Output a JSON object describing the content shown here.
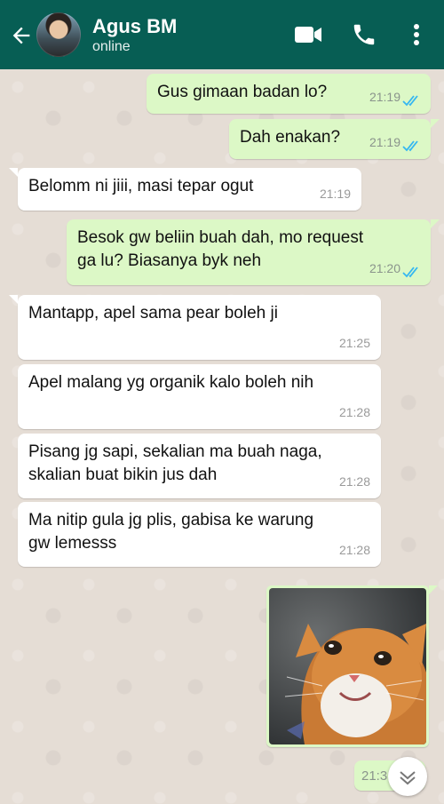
{
  "header": {
    "contact_name": "Agus BM",
    "status": "online",
    "icons": [
      "back-arrow-icon",
      "video-call-icon",
      "phone-icon",
      "more-options-icon"
    ],
    "color": "#075e54"
  },
  "messages": [
    {
      "direction": "out",
      "text": "Gus gimaan badan lo?",
      "time": "21:19",
      "read": true
    },
    {
      "direction": "out",
      "text": "Dah enakan?",
      "time": "21:19",
      "read": true
    },
    {
      "direction": "in",
      "text": "Belomm ni jiii, masi tepar ogut",
      "time": "21:19"
    },
    {
      "direction": "out",
      "text_lines": [
        "Besok gw beliin buah dah, mo request",
        "ga lu? Biasanya byk neh"
      ],
      "time": "21:20",
      "read": true
    },
    {
      "direction": "in",
      "text": "Mantapp, apel sama pear boleh ji",
      "time": "21:25"
    },
    {
      "direction": "in",
      "text": "Apel malang yg organik kalo boleh nih",
      "time": "21:28"
    },
    {
      "direction": "in",
      "text_lines": [
        "Pisang jg sapi, sekalian ma buah naga,",
        "skalian buat bikin jus dah"
      ],
      "time": "21:28"
    },
    {
      "direction": "in",
      "text_lines": [
        "Ma nitip gula jg plis, gabisa ke warung",
        "gw lemesss"
      ],
      "time": "21:28"
    },
    {
      "direction": "out",
      "type": "image",
      "content": "photo of an orange and white cat"
    },
    {
      "direction": "out",
      "time_partial": "21:3"
    }
  ],
  "colors": {
    "outgoing_bubble": "#dcf8c6",
    "incoming_bubble": "#ffffff",
    "read_tick": "#34b7f1"
  }
}
